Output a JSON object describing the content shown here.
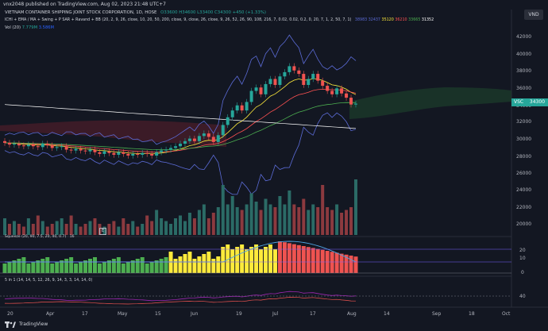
{
  "header": {
    "published": "vnx2048 published on TradingView.com, Aug 02, 2023 21:48 UTC+7",
    "currency": "VND"
  },
  "legend": {
    "symbol": "VIETNAM CONTAINER SHIPPING JOINT STOCK CORPORATION, 1D, HOSE",
    "ohlc": "O33600 H34600 L33400 C34300 +450 (+1.33%)",
    "indicators": "ICHI + EMA / MA + Swing + P SAR + Ravand + BB (20, 2, 9, 26, close, 10, 20, 50, 200, close, 9, close, 26, close, 9, 26, 52, 26, 90, 108, 216, 7, 0.02, 0.02, 0.2, 0, 20, 7, 1, 2, 50, 7, 1)",
    "indicator_values": [
      {
        "text": "38983",
        "color": "#5b6bd6"
      },
      {
        "text": "32437",
        "color": "#5b6bd6"
      },
      {
        "text": "35120",
        "color": "#ffeb3b"
      },
      {
        "text": "36210",
        "color": "#ff5252"
      },
      {
        "text": "33665",
        "color": "#4caf50"
      },
      {
        "text": "31352",
        "color": "#ffffff"
      }
    ],
    "vol_label": "Vol (20)",
    "vol_v1": "7.779M",
    "vol_v2": "3.586M",
    "pane3": "Squeeze (20, 90, 7.5, 20, 40, 0.7)",
    "pane3_value": "16",
    "pane4": "5 in 1 (14, 14, 5, 12, 26, 9, 14, 3, 3, 14, 14, 0)"
  },
  "price_axis": {
    "labels": [
      "42000",
      "40000",
      "38000",
      "36000",
      "34000",
      "32000",
      "30000",
      "28000",
      "26000",
      "24000",
      "22000",
      "20000"
    ],
    "current_symbol": "VSC",
    "current_price": "34300"
  },
  "pane3_axis": [
    "20",
    "10",
    "0"
  ],
  "pane4_axis": [
    "40"
  ],
  "time_axis": [
    "20",
    "Apr",
    "17",
    "May",
    "15",
    "Jun",
    "19",
    "Jul",
    "17",
    "Aug",
    "14",
    "Sep",
    "18",
    "Oct"
  ],
  "marker_label": "E",
  "footer": {
    "brand": "TradingView"
  },
  "colors": {
    "bg": "#131722",
    "up": "#26a69a",
    "down": "#ef5350",
    "ema9": "#ffeb3b",
    "ema20": "#ff5252",
    "ema50": "#4caf50",
    "ma200": "#ffffff",
    "bb": "#5b6bd6"
  },
  "chart_data": {
    "type": "candlestick",
    "title": "VIETNAM CONTAINER SHIPPING JOINT STOCK CORPORATION, 1D, HOSE",
    "ylim": [
      19000,
      43000
    ],
    "candles_close": [
      29700,
      29500,
      29600,
      29400,
      29300,
      29500,
      29300,
      29200,
      29600,
      29400,
      29100,
      29200,
      29300,
      28900,
      28800,
      29000,
      28800,
      28700,
      28900,
      28600,
      28400,
      28700,
      28500,
      28300,
      28600,
      28400,
      28200,
      28400,
      28300,
      28500,
      28400,
      28200,
      28600,
      28800,
      28900,
      29100,
      29300,
      29600,
      29900,
      30200,
      29900,
      30500,
      30800,
      30400,
      29800,
      30600,
      31800,
      32700,
      33500,
      34100,
      33500,
      34500,
      35800,
      36200,
      35400,
      36600,
      37200,
      36500,
      37500,
      38000,
      38700,
      38200,
      37800,
      36500,
      37200,
      37800,
      37000,
      36400,
      35800,
      35400,
      36100,
      35500,
      35000,
      34200,
      34300
    ],
    "volumes_rel": [
      0.3,
      0.2,
      0.25,
      0.2,
      0.15,
      0.3,
      0.2,
      0.35,
      0.25,
      0.15,
      0.2,
      0.25,
      0.3,
      0.2,
      0.35,
      0.2,
      0.15,
      0.2,
      0.25,
      0.3,
      0.2,
      0.15,
      0.2,
      0.25,
      0.15,
      0.3,
      0.2,
      0.25,
      0.15,
      0.2,
      0.35,
      0.25,
      0.45,
      0.3,
      0.25,
      0.2,
      0.3,
      0.35,
      0.25,
      0.4,
      0.3,
      0.45,
      0.55,
      0.3,
      0.4,
      0.5,
      0.9,
      0.55,
      0.7,
      0.5,
      0.45,
      0.55,
      0.75,
      0.6,
      0.45,
      0.65,
      0.55,
      0.5,
      0.7,
      0.55,
      0.8,
      0.55,
      0.5,
      0.65,
      0.45,
      0.55,
      0.5,
      0.9,
      0.5,
      0.45,
      0.55,
      0.4,
      0.45,
      0.5,
      1.0
    ]
  }
}
